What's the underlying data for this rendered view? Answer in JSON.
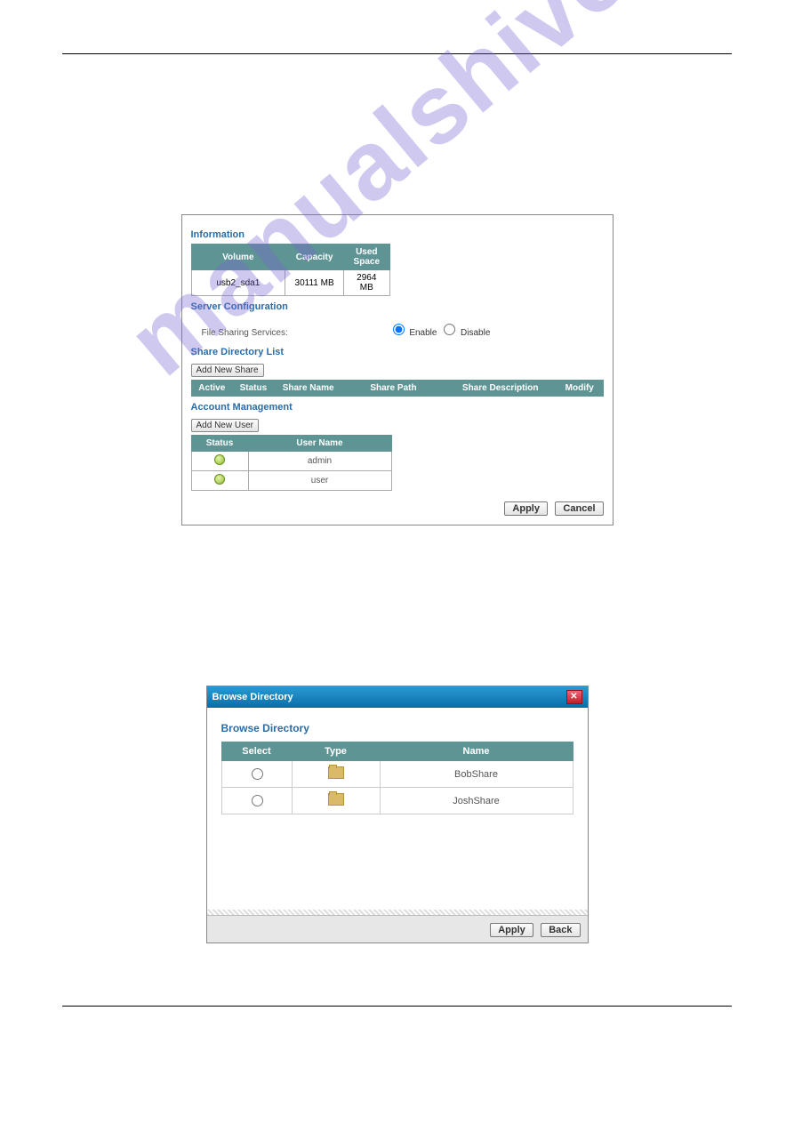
{
  "watermark": "manualshive.com",
  "panel1": {
    "sections": {
      "information": "Information",
      "server_config": "Server Configuration",
      "share_dir": "Share Directory List",
      "account": "Account Management"
    },
    "info_table": {
      "headers": {
        "volume": "Volume",
        "capacity": "Capacity",
        "used": "Used Space"
      },
      "row": {
        "volume": "usb2_sda1",
        "capacity": "30111 MB",
        "used": "2964 MB"
      }
    },
    "config": {
      "label": "File Sharing Services:",
      "enable": "Enable",
      "disable": "Disable"
    },
    "share": {
      "add_btn": "Add New Share",
      "headers": {
        "active": "Active",
        "status": "Status",
        "name": "Share Name",
        "path": "Share Path",
        "desc": "Share Description",
        "modify": "Modify"
      }
    },
    "account_mgmt": {
      "add_btn": "Add New User",
      "headers": {
        "status": "Status",
        "username": "User Name"
      },
      "rows": [
        {
          "status_icon": "user-active-icon",
          "username": "admin"
        },
        {
          "status_icon": "user-active-icon",
          "username": "user"
        }
      ]
    },
    "buttons": {
      "apply": "Apply",
      "cancel": "Cancel"
    }
  },
  "panel2": {
    "title": "Browse Directory",
    "heading": "Browse Directory",
    "headers": {
      "select": "Select",
      "type": "Type",
      "name": "Name"
    },
    "rows": [
      {
        "name": "BobShare"
      },
      {
        "name": "JoshShare"
      }
    ],
    "buttons": {
      "apply": "Apply",
      "back": "Back"
    }
  }
}
